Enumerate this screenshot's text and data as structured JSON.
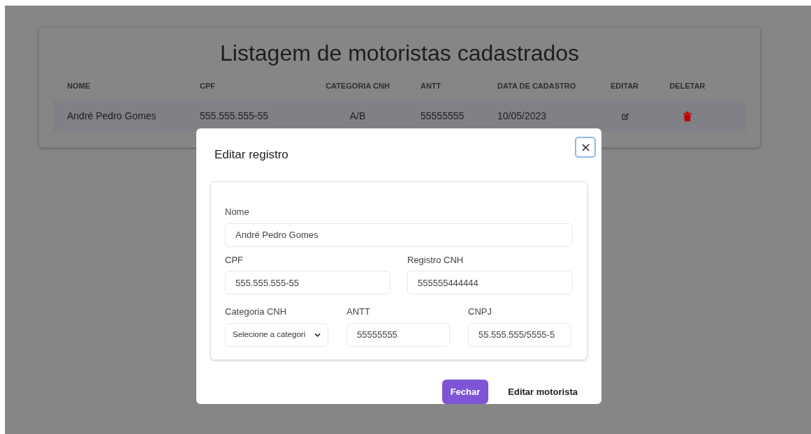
{
  "page": {
    "title": "Listagem de motoristas cadastrados",
    "table": {
      "columns": [
        "NOME",
        "CPF",
        "CATEGORIA CNH",
        "ANTT",
        "DATA DE CADASTRO",
        "EDITAR",
        "DELETAR"
      ],
      "rows": [
        {
          "nome": "André Pedro Gomes",
          "cpf": "555.555.555-55",
          "categoria": "A/B",
          "antt": "55555555",
          "data": "10/05/2023"
        }
      ]
    }
  },
  "modal": {
    "title": "Editar registro",
    "fields": [
      {
        "label": "Nome",
        "value": "André Pedro Gomes",
        "kind": "input"
      },
      {
        "label": "CPF",
        "value": "555.555.555-55",
        "kind": "input"
      },
      {
        "label": "Registro CNH",
        "value": "555555444444",
        "kind": "input"
      },
      {
        "label": "Categoria CNH",
        "value": "Selecione a categori",
        "kind": "select"
      },
      {
        "label": "ANTT",
        "value": "55555555",
        "kind": "input"
      },
      {
        "label": "CNPJ",
        "value": "55.555.555/5555-5",
        "kind": "input"
      }
    ],
    "buttons": [
      {
        "label": "Fechar",
        "kind": "primary"
      },
      {
        "label": "Editar motorista",
        "kind": "plain"
      }
    ]
  }
}
